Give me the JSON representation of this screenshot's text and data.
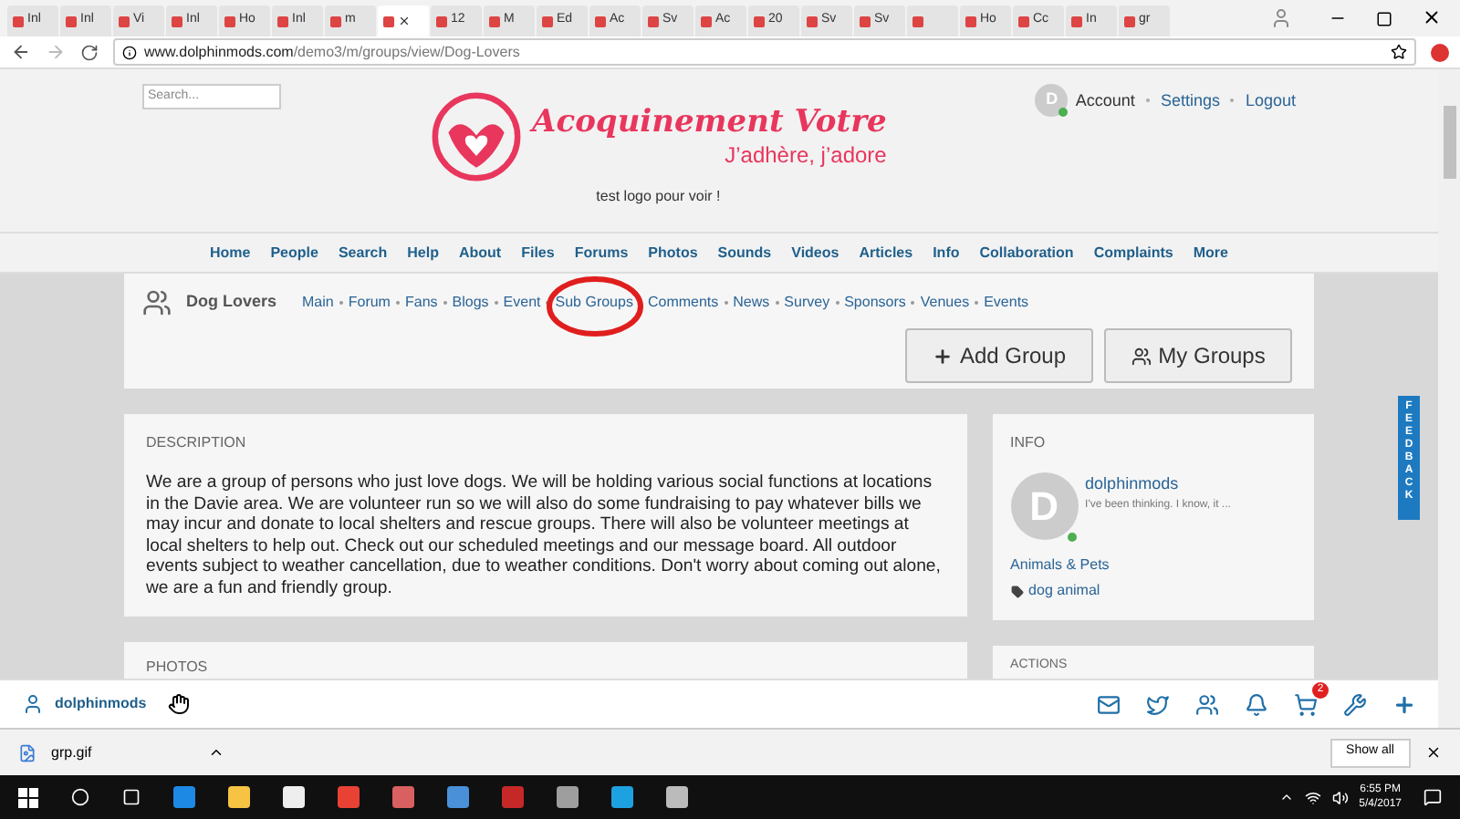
{
  "browser": {
    "tabs": [
      {
        "label": "Inl",
        "selected": false
      },
      {
        "label": "Inl",
        "selected": false
      },
      {
        "label": "Vi",
        "selected": false
      },
      {
        "label": "Inl",
        "selected": false
      },
      {
        "label": "Ho",
        "selected": false
      },
      {
        "label": "Inl",
        "selected": false
      },
      {
        "label": "m",
        "selected": false
      },
      {
        "selected": true
      },
      {
        "label": "12",
        "selected": false
      },
      {
        "label": "M",
        "selected": false
      },
      {
        "label": "Ed",
        "selected": false
      },
      {
        "label": "Ac",
        "selected": false
      },
      {
        "label": "Sv",
        "selected": false
      },
      {
        "label": "Ac",
        "selected": false
      },
      {
        "label": "20",
        "selected": false
      },
      {
        "label": "Sv",
        "selected": false
      },
      {
        "label": "Sv",
        "selected": false
      },
      {
        "selected": false
      },
      {
        "label": "Ho",
        "selected": false
      },
      {
        "label": "Cc",
        "selected": false
      },
      {
        "label": "In",
        "selected": false
      },
      {
        "label": "gr",
        "selected": false
      }
    ],
    "url_host": "www.dolphinmods.com",
    "url_path": "/demo3/m/groups/view/Dog-Lovers"
  },
  "header": {
    "search": {
      "placeholder": "Search..."
    },
    "brand": "Acoquinement Votre",
    "tagline": "J’adhère, j’adore",
    "caption": "test logo pour voir !",
    "avatar_letter": "D",
    "account_links": [
      "Account",
      "Settings",
      "Logout"
    ]
  },
  "nav": [
    "Home",
    "People",
    "Search",
    "Help",
    "About",
    "Files",
    "Forums",
    "Photos",
    "Sounds",
    "Videos",
    "Articles",
    "Info",
    "Collaboration",
    "Complaints",
    "More"
  ],
  "group": {
    "name": "Dog Lovers",
    "links": [
      {
        "label": "Main",
        "circled": false
      },
      {
        "label": "Forum",
        "circled": false
      },
      {
        "label": "Fans",
        "circled": false
      },
      {
        "label": "Blogs",
        "circled": false
      },
      {
        "label": "Event",
        "circled": false
      },
      {
        "label": "Sub Groups",
        "circled": true
      },
      {
        "label": "Comments",
        "circled": false
      },
      {
        "label": "News",
        "circled": false
      },
      {
        "label": "Survey",
        "circled": false
      },
      {
        "label": "Sponsors",
        "circled": false
      },
      {
        "label": "Venues",
        "circled": false
      },
      {
        "label": "Events",
        "circled": false
      }
    ],
    "buttons": [
      "Add Group",
      "My Groups"
    ]
  },
  "description": {
    "title": "DESCRIPTION",
    "text": "We are a group of persons who just love dogs. We will be holding various social functions at locations in the Davie area. We are volunteer run so we will also do some fundraising to pay whatever  bills we may incur and donate to local shelters and rescue groups. There will also be volunteer meetings at local shelters to help out. Check out our scheduled meetings and our message board. All outdoor events subject to weather cancellation, due to weather conditions. Don't worry about coming out alone, we are a fun and friendly group."
  },
  "info": {
    "title": "INFO",
    "avatar_letter": "D",
    "online": true,
    "user": "dolphinmods",
    "status": "I've been thinking. I know, it ...",
    "category": "Animals & Pets",
    "tags": "dog animal"
  },
  "photos": {
    "title": "PHOTOS"
  },
  "actions": {
    "title": "ACTIONS"
  },
  "feedback": "FEEDBACK",
  "bottom_bar": {
    "user": "dolphinmods",
    "cart_count": "2"
  },
  "downloads": {
    "file": "grp.gif",
    "show_all": "Show all"
  },
  "taskbar": {
    "time": "6:55 PM",
    "date": "5/4/2017"
  }
}
